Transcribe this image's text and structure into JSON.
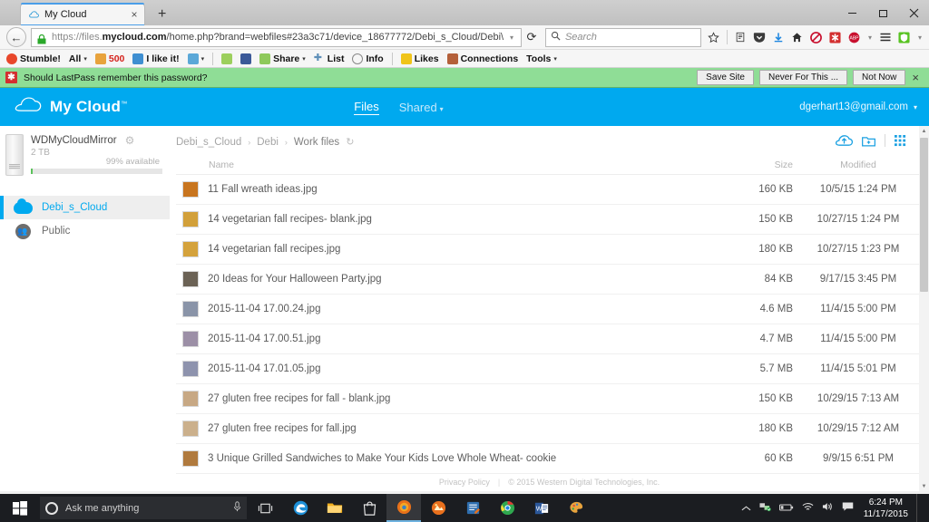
{
  "browser": {
    "tab": {
      "title": "My Cloud",
      "favicon": "cloud-icon",
      "close": "×"
    },
    "newtab_label": "+",
    "window_controls": {
      "minimize": "minimize-icon",
      "maximize": "maximize-icon",
      "close": "close-icon"
    },
    "nav": {
      "back": "←",
      "reload": "⟳",
      "url_scheme": "https://files.",
      "url_domain": "mycloud.com",
      "url_path": "/home.php?brand=webfiles#23a3c71/device_18677772/Debi_s_Cloud/Debi\\",
      "url_caret": "▾",
      "lock": "lock-icon"
    },
    "search": {
      "placeholder": "Search",
      "icon": "search-icon"
    },
    "toolbar_icons": [
      "bookmark-star-icon",
      "reader-icon",
      "pocket-icon",
      "downloads-icon",
      "home-icon",
      "adblock-icon",
      "lastpass-icon",
      "abp-icon",
      "hamburger-menu-icon",
      "wot-icon"
    ],
    "bookmarks": [
      {
        "label": "Stumble!",
        "icon": "stumbleupon-icon",
        "caret": ""
      },
      {
        "label": "All",
        "icon": "",
        "caret": "▾"
      },
      {
        "label": "500",
        "icon": "badge-icon",
        "caret": ""
      },
      {
        "label": "I like it!",
        "icon": "thumbs-up-icon",
        "caret": ""
      },
      {
        "label": "",
        "icon": "thumbs-down-icon",
        "caret": "▾"
      },
      {
        "label": "",
        "icon": "tag-icon",
        "caret": ""
      },
      {
        "label": "",
        "icon": "facebook-icon",
        "caret": ""
      },
      {
        "label": "Share",
        "icon": "share-icon",
        "caret": "▾"
      },
      {
        "label": "List",
        "icon": "plus-icon",
        "caret": ""
      },
      {
        "label": "Info",
        "icon": "info-icon",
        "caret": ""
      },
      {
        "label": "Likes",
        "icon": "star-icon",
        "caret": ""
      },
      {
        "label": "Connections",
        "icon": "people-icon",
        "caret": ""
      },
      {
        "label": "Tools",
        "icon": "",
        "caret": "▾"
      }
    ]
  },
  "notification": {
    "icon": "lastpass-icon",
    "icon_glyph": "✱",
    "message": "Should LastPass remember this password?",
    "buttons": [
      "Save Site",
      "Never For This ...",
      "Not Now"
    ],
    "close": "×",
    "background": "#8fdd96"
  },
  "mycloud": {
    "brand": "My Cloud",
    "brand_tm": "™",
    "logo": "cloud-icon",
    "accent": "#00a9ef",
    "nav": [
      {
        "label": "Files",
        "active": true,
        "caret": ""
      },
      {
        "label": "Shared",
        "active": false,
        "caret": "▾"
      }
    ],
    "user": {
      "email": "dgerhart13@gmail.com",
      "caret": "▾"
    },
    "device": {
      "name": "WDMyCloudMirror",
      "capacity": "2 TB",
      "available": "99% available",
      "gear_icon": "gear-icon"
    },
    "sidebar_items": [
      {
        "label": "Debi_s_Cloud",
        "icon": "cloud-icon",
        "selected": true
      },
      {
        "label": "Public",
        "icon": "people-icon",
        "selected": false
      }
    ],
    "breadcrumb": [
      "Debi_s_Cloud",
      "Debi",
      "Work files"
    ],
    "breadcrumb_sep": "›",
    "refresh_icon": "refresh-icon",
    "toolbar": [
      {
        "name": "upload-icon",
        "label": ""
      },
      {
        "name": "new-folder-icon",
        "label": ""
      },
      {
        "name": "grid-view-icon",
        "label": ""
      }
    ],
    "columns": {
      "name": "Name",
      "size": "Size",
      "modified": "Modified"
    },
    "files": [
      {
        "name": "11 Fall wreath ideas.jpg",
        "size": "160 KB",
        "modified": "10/5/15 1:24 PM",
        "thumb": "#c8751f"
      },
      {
        "name": "14 vegetarian fall recipes- blank.jpg",
        "size": "150 KB",
        "modified": "10/27/15 1:24 PM",
        "thumb": "#d2a03a"
      },
      {
        "name": "14 vegetarian fall recipes.jpg",
        "size": "180 KB",
        "modified": "10/27/15 1:23 PM",
        "thumb": "#d4a23c"
      },
      {
        "name": "20 Ideas for Your Halloween Party.jpg",
        "size": "84 KB",
        "modified": "9/17/15 3:45 PM",
        "thumb": "#6b6255"
      },
      {
        "name": "2015-11-04 17.00.24.jpg",
        "size": "4.6 MB",
        "modified": "11/4/15 5:00 PM",
        "thumb": "#8a94a8"
      },
      {
        "name": "2015-11-04 17.00.51.jpg",
        "size": "4.7 MB",
        "modified": "11/4/15 5:00 PM",
        "thumb": "#9c8fa6"
      },
      {
        "name": "2015-11-04 17.01.05.jpg",
        "size": "5.7 MB",
        "modified": "11/4/15 5:01 PM",
        "thumb": "#8e93ad"
      },
      {
        "name": "27 gluten free recipes for fall - blank.jpg",
        "size": "150 KB",
        "modified": "10/29/15 7:13 AM",
        "thumb": "#c7a884"
      },
      {
        "name": "27 gluten free recipes for fall.jpg",
        "size": "180 KB",
        "modified": "10/29/15 7:12 AM",
        "thumb": "#cbb08c"
      },
      {
        "name": "3 Unique Grilled Sandwiches to Make Your Kids Love Whole Wheat- cookie",
        "size": "60 KB",
        "modified": "9/9/15 6:51 PM",
        "thumb": "#b07a3e"
      }
    ],
    "footer": {
      "privacy": "Privacy Policy",
      "copyright": "© 2015 Western Digital Technologies, Inc."
    }
  },
  "taskbar": {
    "start": "windows-start-icon",
    "cortana_placeholder": "Ask me anything",
    "mic_icon": "microphone-icon",
    "taskview_icon": "task-view-icon",
    "apps": [
      {
        "name": "edge-icon",
        "active": false
      },
      {
        "name": "file-explorer-icon",
        "active": false
      },
      {
        "name": "store-icon",
        "active": false
      },
      {
        "name": "firefox-icon",
        "active": true
      },
      {
        "name": "photo-app-icon",
        "active": false
      },
      {
        "name": "sticky-notes-icon",
        "active": false
      },
      {
        "name": "chrome-icon",
        "active": false
      },
      {
        "name": "word-icon",
        "active": false
      },
      {
        "name": "paint-icon",
        "active": false
      }
    ],
    "tray": [
      "chevron-up-icon",
      "network-icon",
      "battery-icon",
      "wifi-icon",
      "volume-icon",
      "action-center-icon"
    ],
    "time": "6:24 PM",
    "date": "11/17/2015"
  }
}
